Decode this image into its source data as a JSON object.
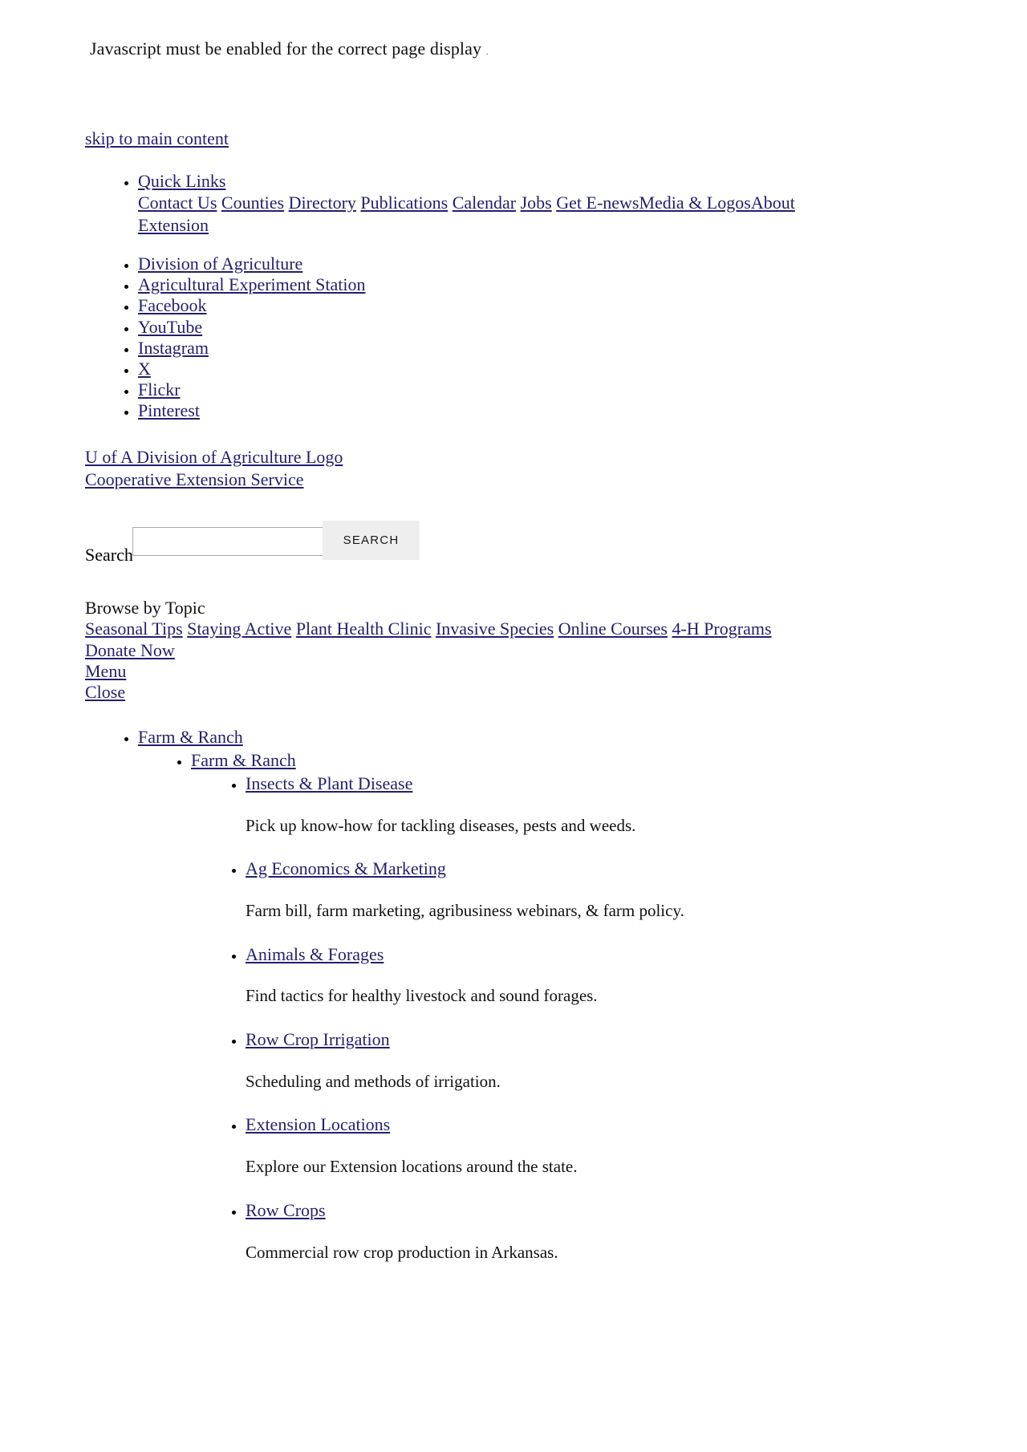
{
  "notice": {
    "text": "Javascript must be enabled for the correct page display",
    "trailing": "."
  },
  "skip_link": "skip to main content",
  "quick_links": {
    "heading": "Quick Links",
    "items": [
      "Contact Us",
      "Counties",
      "Directory",
      "Publications",
      "Calendar",
      "Jobs",
      "Get E-news",
      "Media & Logos",
      "About Extension"
    ]
  },
  "social_links": [
    "Division of Agriculture",
    "Agricultural Experiment Station",
    "Facebook",
    "YouTube",
    "Instagram",
    "X",
    "Flickr",
    "Pinterest"
  ],
  "branding": {
    "logo_alt": "U of A Division of Agriculture Logo",
    "site_name": "Cooperative Extension Service"
  },
  "search": {
    "label": "Search",
    "value": "",
    "placeholder": "",
    "button_label": "SEARCH"
  },
  "browse": {
    "title": "Browse by Topic",
    "topics": [
      "Seasonal Tips",
      "Staying Active",
      "Plant Health Clinic",
      "Invasive Species",
      "Online Courses",
      "4-H Programs"
    ],
    "donate_label": "Donate Now",
    "menu_label": "Menu ",
    "close_label": "Close "
  },
  "main_menu": {
    "top_label": "Farm & Ranch",
    "section_label": "Farm & Ranch ",
    "items": [
      {
        "label": "Insects & Plant Disease",
        "description": "Pick up know-how for tackling diseases, pests and weeds."
      },
      {
        "label": "Ag Economics & Marketing",
        "description": "Farm bill, farm marketing, agribusiness webinars, & farm policy."
      },
      {
        "label": "Animals & Forages",
        "description": "Find tactics for healthy livestock and sound forages."
      },
      {
        "label": "Row Crop Irrigation",
        "description": "Scheduling and methods of irrigation."
      },
      {
        "label": "Extension Locations",
        "description": "Explore our Extension locations around the state."
      },
      {
        "label": "Row Crops",
        "description": "Commercial row crop production in Arkansas."
      }
    ]
  },
  "colors": {
    "link": "#231f6e",
    "text": "#000000",
    "background": "#ffffff",
    "button_bg": "#eeeeee",
    "input_border": "#a9a9a9"
  }
}
